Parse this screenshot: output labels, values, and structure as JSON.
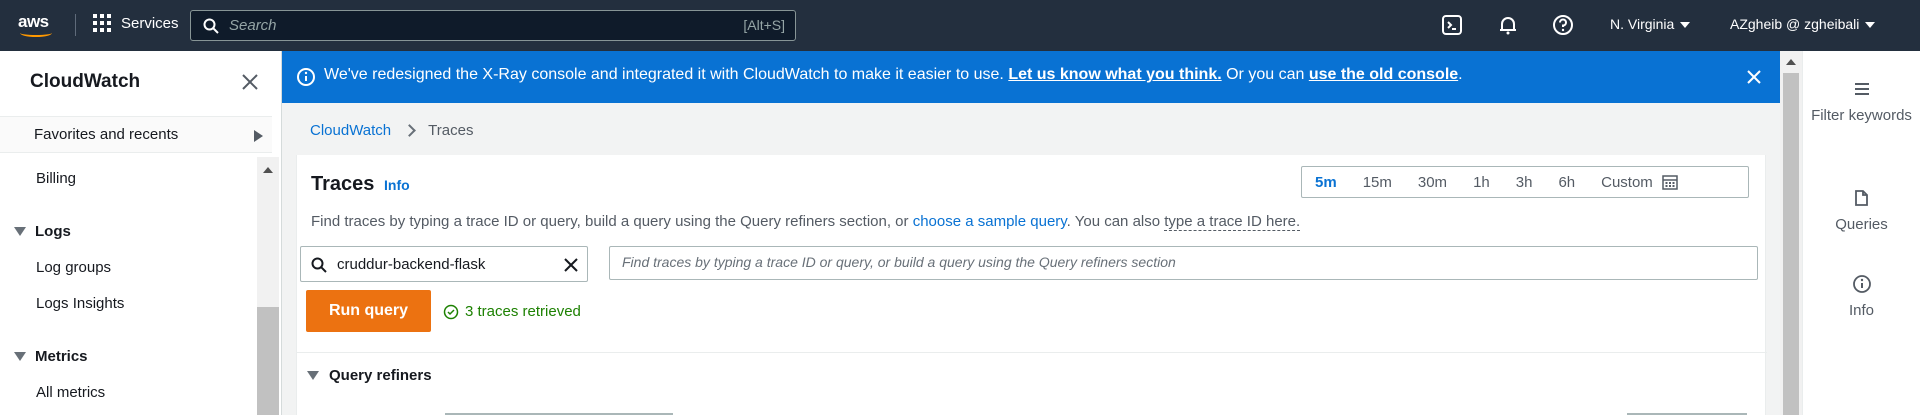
{
  "topnav": {
    "logo": "aws",
    "services_label": "Services",
    "search_placeholder": "Search",
    "search_shortcut": "[Alt+S]",
    "region": "N. Virginia",
    "account": "AZgheib @ zgheibali"
  },
  "sidebar": {
    "title": "CloudWatch",
    "favorites": "Favorites and recents",
    "billing": "Billing",
    "logs_section": "Logs",
    "log_groups": "Log groups",
    "logs_insights": "Logs Insights",
    "metrics_section": "Metrics",
    "all_metrics": "All metrics"
  },
  "banner": {
    "text_before": "We've redesigned the X-Ray console and integrated it with CloudWatch to make it easier to use. ",
    "link1": "Let us know what you think.",
    "text_middle": " Or you can ",
    "link2": "use the old console",
    "text_after": "."
  },
  "breadcrumb": {
    "root": "CloudWatch",
    "current": "Traces"
  },
  "traces": {
    "title": "Traces",
    "info": "Info",
    "time_ranges": [
      "5m",
      "15m",
      "30m",
      "1h",
      "3h",
      "6h"
    ],
    "custom": "Custom",
    "desc_before": "Find traces by typing a trace ID or query, build a query using the Query refiners section, or ",
    "desc_link": "choose a sample query",
    "desc_middle": ". You can also ",
    "desc_dotted": "type a trace ID here.",
    "filter_value": "cruddur-backend-flask",
    "query_placeholder": "Find traces by typing a trace ID or query, or build a query using the Query refiners section",
    "run_button": "Run query",
    "status": "3 traces retrieved",
    "refiners": "Query refiners"
  },
  "rail": {
    "filter": "Filter keywords",
    "queries": "Queries",
    "info": "Info"
  },
  "colors": {
    "nav_bg": "#232f3e",
    "banner_bg": "#0972d3",
    "accent_orange": "#ec7211",
    "link_blue": "#0972d3",
    "success_green": "#1d8102"
  }
}
